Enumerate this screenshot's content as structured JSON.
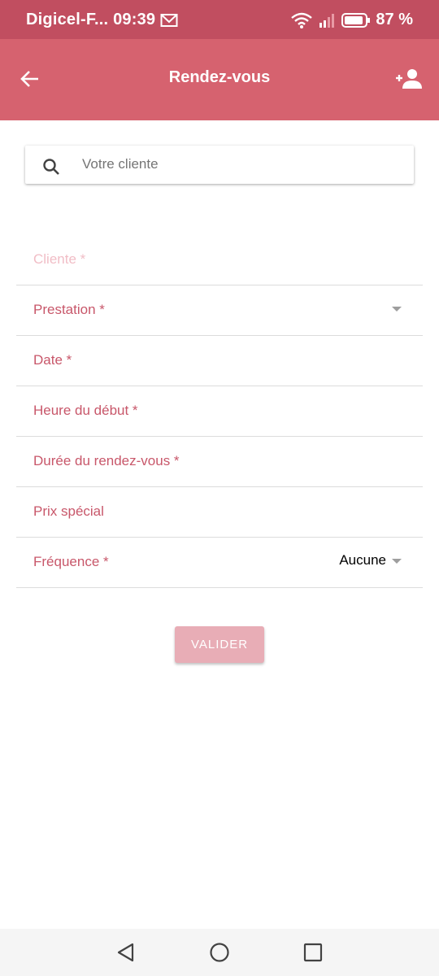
{
  "status_bar": {
    "carrier_time": "Digicel-F... 09:39",
    "battery": "87 %"
  },
  "app_bar": {
    "title": "Rendez-vous"
  },
  "search": {
    "placeholder": "Votre cliente"
  },
  "form": {
    "fields": [
      {
        "label": "Cliente *"
      },
      {
        "label": "Prestation *"
      },
      {
        "label": "Date *"
      },
      {
        "label": "Heure du début *"
      },
      {
        "label": "Durée du rendez-vous *"
      },
      {
        "label": "Prix spécial"
      },
      {
        "label": "Fréquence *",
        "value": "Aucune"
      }
    ],
    "submit_label": "VALIDER"
  },
  "colors": {
    "status_bar": "#c14e60",
    "app_bar": "#d6626f",
    "label": "#c8576a",
    "button": "#e8adb6"
  }
}
